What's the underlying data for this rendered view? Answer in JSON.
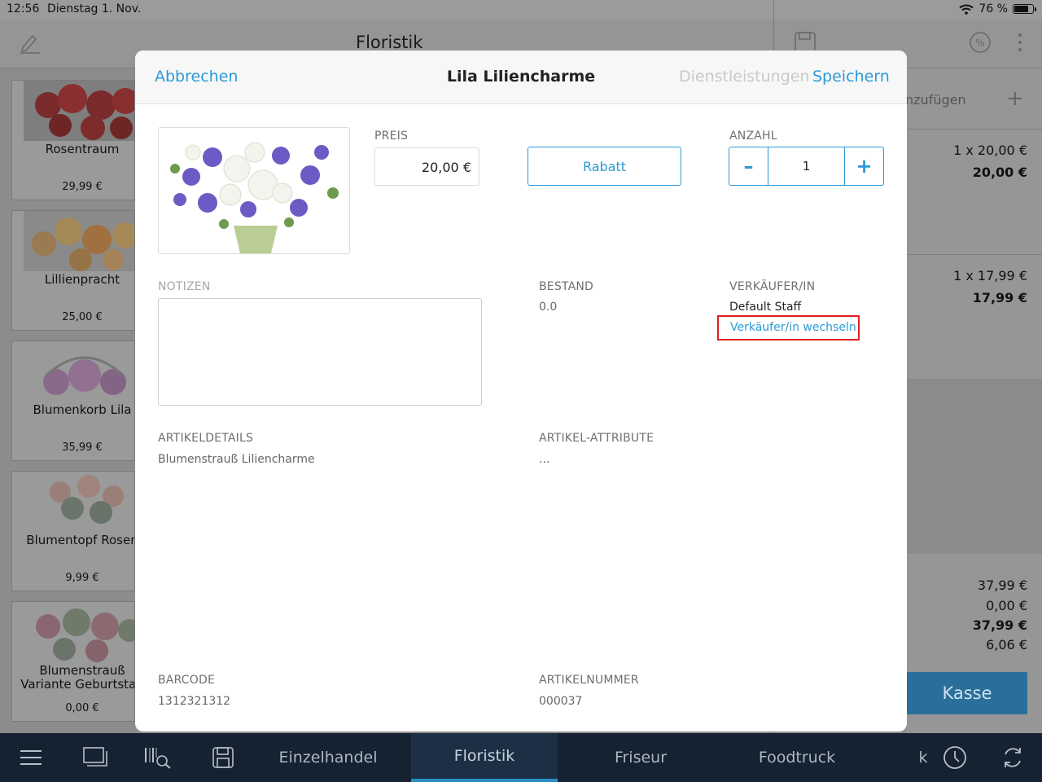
{
  "status": {
    "time": "12:56",
    "date": "Dienstag 1. Nov.",
    "battery": "76 %",
    "battery_level": 0.76
  },
  "background": {
    "title": "Floristik",
    "add_text": "nzufügen",
    "products": [
      {
        "name": "Rosentraum",
        "price": "29,99 €"
      },
      {
        "name": "Lillienpracht",
        "price": "25,00 €"
      },
      {
        "name": "Blumenkorb Lila",
        "price": "35,99 €"
      },
      {
        "name": "Blumentopf Rosen",
        "price": "9,99 €"
      },
      {
        "name": "Blumenstrauß Variante Geburtstag",
        "price": "0,00 €"
      }
    ],
    "cart_lines": [
      {
        "qty": "1 x 20,00 €",
        "total": "20,00 €"
      },
      {
        "qty": "1 x 17,99 €",
        "total": "17,99 €"
      }
    ],
    "totals": {
      "subtotal": "37,99 €",
      "discount": "0,00 €",
      "total": "37,99 €",
      "tax": "6,06 €"
    },
    "checkout_label": "Kasse"
  },
  "bottom_nav": {
    "tabs": [
      "Einzelhandel",
      "Floristik",
      "Friseur",
      "Foodtruck",
      "k"
    ],
    "active": "Floristik"
  },
  "modal": {
    "cancel_label": "Abbrechen",
    "title": "Lila Liliencharme",
    "services_label": "Dienstleistungen",
    "save_label": "Speichern",
    "price_label": "PREIS",
    "price_value": "20,00 €",
    "discount_label": "Rabatt",
    "quantity_label": "ANZAHL",
    "quantity_value": "1",
    "minus": "–",
    "plus": "+",
    "notes_label": "NOTIZEN",
    "stock_label": "BESTAND",
    "stock_value": "0.0",
    "seller_label": "VERKÄUFER/IN",
    "seller_value": "Default Staff",
    "change_seller_label": "Verkäufer/in wechseln",
    "details_label": "ARTIKELDETAILS",
    "details_value": "Blumenstrauß Liliencharme",
    "attributes_label": "ARTIKEL-ATTRIBUTE",
    "attributes_value": "...",
    "barcode_label": "BARCODE",
    "barcode_value": "1312321312",
    "article_no_label": "ARTIKELNUMMER",
    "article_no_value": "000037"
  }
}
